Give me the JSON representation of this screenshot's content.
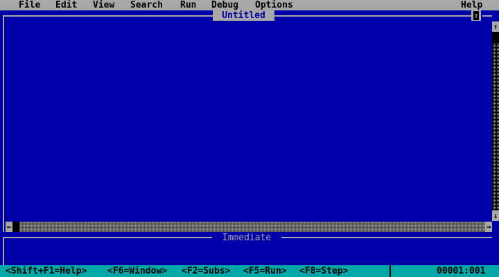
{
  "menu": {
    "file": "File",
    "edit": "Edit",
    "view": "View",
    "search": "Search",
    "run": "Run",
    "debug": "Debug",
    "options": "Options",
    "help": "Help"
  },
  "editor": {
    "title": "Untitled",
    "maximize_icon": "up-arrow-icon"
  },
  "scrollbars": {
    "up_arrow": "↑",
    "down_arrow": "↓",
    "left_arrow": "←",
    "right_arrow": "→"
  },
  "immediate": {
    "title": "Immediate"
  },
  "status": {
    "shift_f1": "<Shift+F1=Help>",
    "f6": "<F6=Window>",
    "f2": "<F2=Subs>",
    "f5": "<F5=Run>",
    "f8": "<F8=Step>",
    "position": "00001:001"
  },
  "colors": {
    "background": "#0000a8",
    "chrome": "#a8a8a8",
    "statusbar": "#00a8a8"
  }
}
